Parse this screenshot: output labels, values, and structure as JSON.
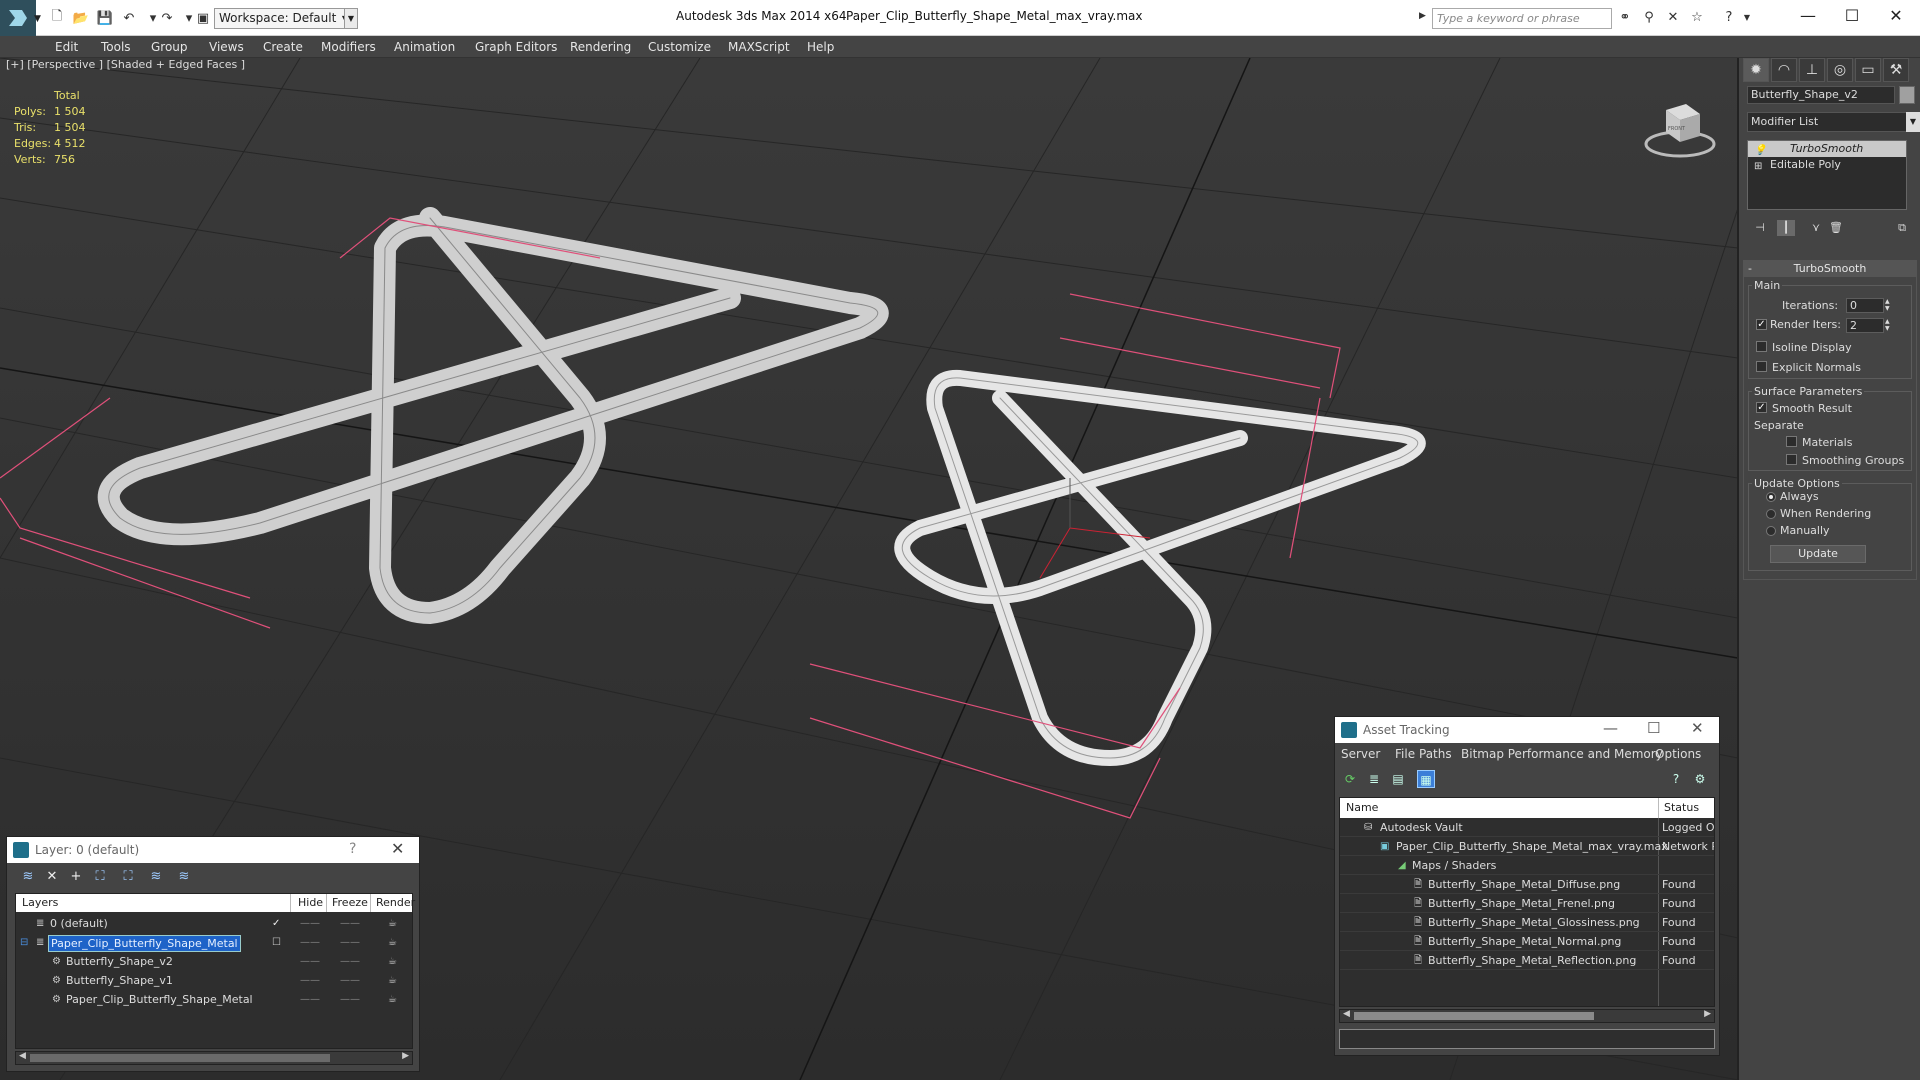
{
  "titlebar": {
    "workspace": "Workspace: Default",
    "app_title": "Autodesk 3ds Max  2014 x64",
    "file_title": "Paper_Clip_Butterfly_Shape_Metal_max_vray.max",
    "search_placeholder": "Type a keyword or phrase"
  },
  "menu": [
    "Edit",
    "Tools",
    "Group",
    "Views",
    "Create",
    "Modifiers",
    "Animation",
    "Graph Editors",
    "Rendering",
    "Customize",
    "MAXScript",
    "Help"
  ],
  "viewport": {
    "label": "[+] [Perspective ] [Shaded + Edged Faces ]",
    "stats": {
      "header": "Total",
      "rows": [
        {
          "label": "Polys:",
          "value": "1 504"
        },
        {
          "label": "Tris:",
          "value": "1 504"
        },
        {
          "label": "Edges:",
          "value": "4 512"
        },
        {
          "label": "Verts:",
          "value": "756"
        }
      ]
    },
    "viewcube_label": "FRONT"
  },
  "command_panel": {
    "object_name": "Butterfly_Shape_v2",
    "modifier_list": "Modifier List",
    "stack": [
      "TurboSmooth",
      "Editable Poly"
    ],
    "turbosmooth": {
      "title": "TurboSmooth",
      "main_group": "Main",
      "iterations_label": "Iterations:",
      "iterations_value": "0",
      "render_iters_label": "Render Iters:",
      "render_iters_value": "2",
      "isoline_label": "Isoline Display",
      "explicit_normals_label": "Explicit Normals",
      "surface_group": "Surface Parameters",
      "smooth_result_label": "Smooth Result",
      "separate_label": "Separate",
      "materials_label": "Materials",
      "smoothing_groups_label": "Smoothing Groups",
      "update_group": "Update Options",
      "always_label": "Always",
      "when_rendering_label": "When Rendering",
      "manually_label": "Manually",
      "update_button": "Update"
    }
  },
  "layer_dialog": {
    "title": "Layer: 0 (default)",
    "help": "?",
    "columns": [
      "Layers",
      "Hide",
      "Freeze",
      "Render"
    ],
    "rows": [
      {
        "name": "0 (default)",
        "indent": 0
      },
      {
        "name": "Paper_Clip_Butterfly_Shape_Metal",
        "indent": 0
      },
      {
        "name": "Butterfly_Shape_v2",
        "indent": 1
      },
      {
        "name": "Butterfly_Shape_v1",
        "indent": 1
      },
      {
        "name": "Paper_Clip_Butterfly_Shape_Metal",
        "indent": 1
      }
    ]
  },
  "asset_dialog": {
    "title": "Asset Tracking",
    "menu": [
      "Server",
      "File",
      "Paths",
      "Bitmap Performance and Memory",
      "Options"
    ],
    "columns": [
      "Name",
      "Status"
    ],
    "rows": [
      {
        "name": "Autodesk Vault",
        "status": "Logged Ou"
      },
      {
        "name": "Paper_Clip_Butterfly_Shape_Metal_max_vray.max",
        "status": "Network P"
      },
      {
        "name": "Maps / Shaders",
        "status": ""
      },
      {
        "name": "Butterfly_Shape_Metal_Diffuse.png",
        "status": "Found"
      },
      {
        "name": "Butterfly_Shape_Metal_Frenel.png",
        "status": "Found"
      },
      {
        "name": "Butterfly_Shape_Metal_Glossiness.png",
        "status": "Found"
      },
      {
        "name": "Butterfly_Shape_Metal_Normal.png",
        "status": "Found"
      },
      {
        "name": "Butterfly_Shape_Metal_Reflection.png",
        "status": "Found"
      }
    ]
  },
  "colors": {
    "stats_yellow": "#e9e06a",
    "selection_blue": "#1e63c8",
    "bbox_pink": "#e0507a"
  }
}
